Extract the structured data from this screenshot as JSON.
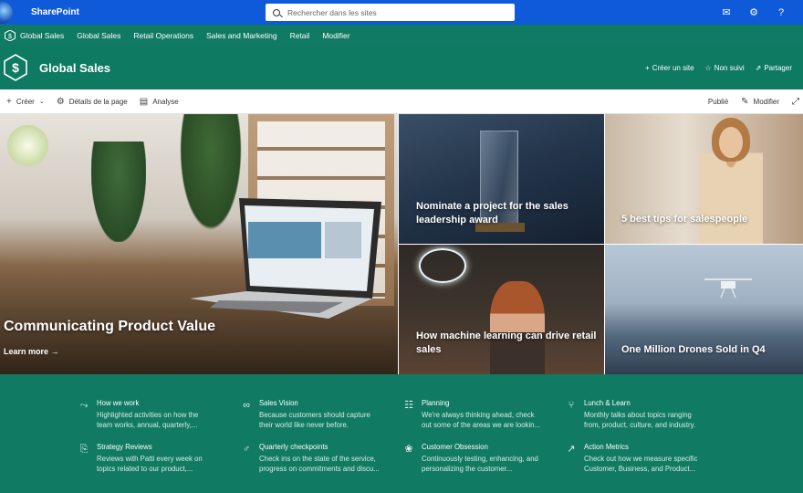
{
  "suite_bar": {
    "app_name": "SharePoint",
    "search_placeholder": "Rechercher dans les sites",
    "icons": [
      "megaphone-icon",
      "gear-icon",
      "help-icon"
    ],
    "icon_glyphs": [
      "✉",
      "⚙",
      "?"
    ]
  },
  "hub_nav": {
    "site_name": "Global Sales",
    "items": [
      "Global Sales",
      "Retail Operations",
      "Sales and Marketing",
      "Retail",
      "Modifier"
    ]
  },
  "site_header": {
    "title": "Global Sales",
    "actions": {
      "create_site": "Créer un site",
      "follow": "Non suivi",
      "share": "Partager"
    }
  },
  "command_bar": {
    "create": "Créer",
    "page_details": "Détails de la page",
    "analytics": "Analyse",
    "published": "Publié",
    "edit": "Modifier"
  },
  "hero": {
    "main": {
      "title": "Communicating Product Value",
      "link": "Learn more"
    },
    "tiles": [
      {
        "title": "Nominate a project for the sales leadership award"
      },
      {
        "title": "5 best tips for salespeople"
      },
      {
        "title": "How machine learning can drive retail sales"
      },
      {
        "title": "One Million Drones Sold in Q4"
      }
    ]
  },
  "quick_links": [
    {
      "title": "How we work",
      "desc1": "Highlighted activities on how the",
      "desc2": "team works, annual, quarterly,...",
      "icon": "flow-icon",
      "glyph": "⤳"
    },
    {
      "title": "Sales Vision",
      "desc1": "Because customers should capture",
      "desc2": "their world like never before.",
      "icon": "glasses-icon",
      "glyph": "∞"
    },
    {
      "title": "Planning",
      "desc1": "We're always thinking ahead, check",
      "desc2": "out some of the areas we are lookin...",
      "icon": "planner-icon",
      "glyph": "☷"
    },
    {
      "title": "Lunch & Learn",
      "desc1": "Monthly talks about topics ranging",
      "desc2": "from, product, culture, and industry.",
      "icon": "utensils-icon",
      "glyph": "⑂"
    },
    {
      "title": "Strategy Reviews",
      "desc1": "Reviews with Patti every week on",
      "desc2": "topics related to our product,...",
      "icon": "document-icon",
      "glyph": "⎘"
    },
    {
      "title": "Quarterly checkpoints",
      "desc1": "Check ins on the state of the service,",
      "desc2": "progress on commitments and discu...",
      "icon": "person-flag-icon",
      "glyph": "♂"
    },
    {
      "title": "Customer Obsession",
      "desc1": "Continuously testing, enhancing, and",
      "desc2": "personalizing the customer...",
      "icon": "gear-star-icon",
      "glyph": "❀"
    },
    {
      "title": "Action Metrics",
      "desc1": "Check out how we measure specific",
      "desc2": "Customer, Business, and Product...",
      "icon": "chart-line-icon",
      "glyph": "↗"
    }
  ]
}
